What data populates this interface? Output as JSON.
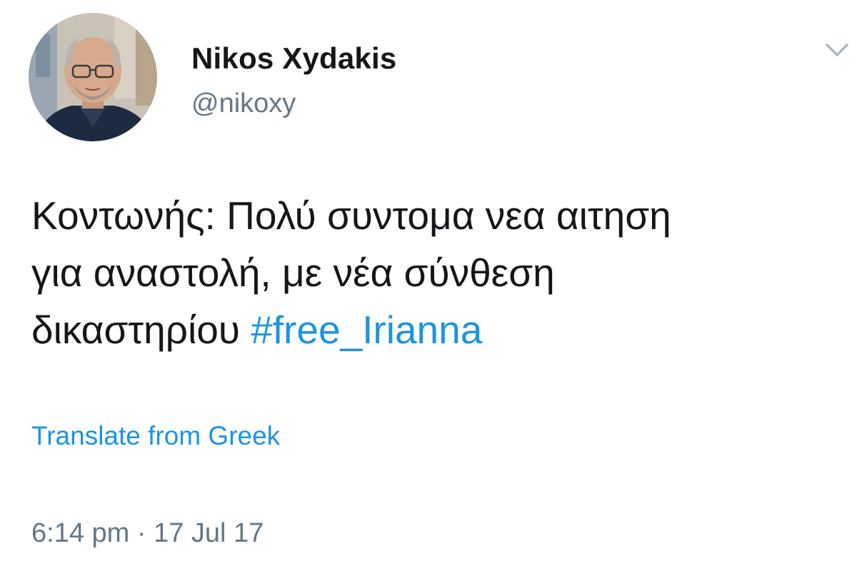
{
  "author": {
    "display_name": "Nikos Xydakis",
    "handle": "@nikoxy",
    "avatar_icon": "avatar-photo-icon"
  },
  "menu": {
    "icon": "chevron-down-icon"
  },
  "tweet": {
    "line1": "Κοντωνής: Πολύ συντομα νεα αιτηση",
    "line2": "για αναστολή, με νέα σύνθεση",
    "line3_text": "δικαστηρίου ",
    "hashtag": "#free_Irianna"
  },
  "translate_label": "Translate from Greek",
  "timestamp": "6:14 pm · 17 Jul 17",
  "colors": {
    "link": "#1b95e0",
    "text": "#14171a",
    "secondary": "#657786",
    "chevron": "#aab8c2"
  }
}
